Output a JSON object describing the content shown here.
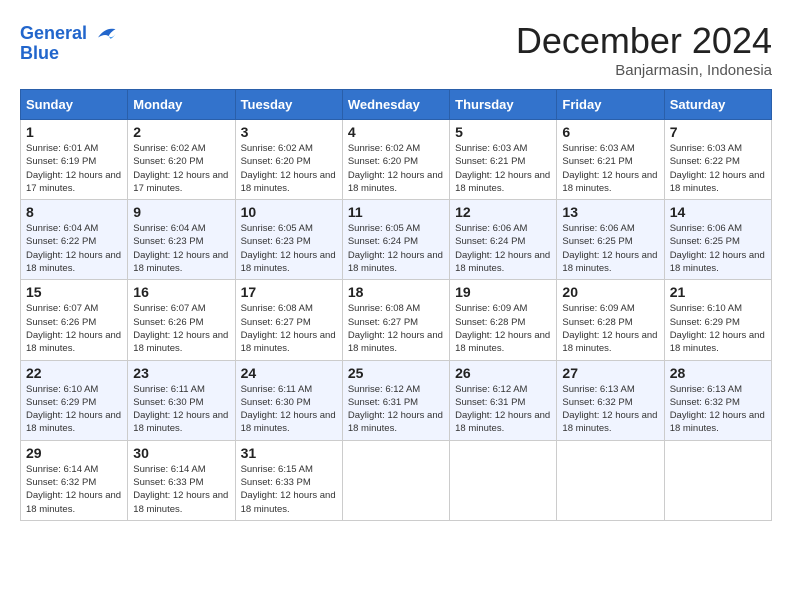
{
  "logo": {
    "line1": "General",
    "line2": "Blue"
  },
  "title": "December 2024",
  "subtitle": "Banjarmasin, Indonesia",
  "days_header": [
    "Sunday",
    "Monday",
    "Tuesday",
    "Wednesday",
    "Thursday",
    "Friday",
    "Saturday"
  ],
  "weeks": [
    [
      {
        "day": "1",
        "sunrise": "6:01 AM",
        "sunset": "6:19 PM",
        "daylight": "12 hours and 17 minutes."
      },
      {
        "day": "2",
        "sunrise": "6:02 AM",
        "sunset": "6:20 PM",
        "daylight": "12 hours and 17 minutes."
      },
      {
        "day": "3",
        "sunrise": "6:02 AM",
        "sunset": "6:20 PM",
        "daylight": "12 hours and 18 minutes."
      },
      {
        "day": "4",
        "sunrise": "6:02 AM",
        "sunset": "6:20 PM",
        "daylight": "12 hours and 18 minutes."
      },
      {
        "day": "5",
        "sunrise": "6:03 AM",
        "sunset": "6:21 PM",
        "daylight": "12 hours and 18 minutes."
      },
      {
        "day": "6",
        "sunrise": "6:03 AM",
        "sunset": "6:21 PM",
        "daylight": "12 hours and 18 minutes."
      },
      {
        "day": "7",
        "sunrise": "6:03 AM",
        "sunset": "6:22 PM",
        "daylight": "12 hours and 18 minutes."
      }
    ],
    [
      {
        "day": "8",
        "sunrise": "6:04 AM",
        "sunset": "6:22 PM",
        "daylight": "12 hours and 18 minutes."
      },
      {
        "day": "9",
        "sunrise": "6:04 AM",
        "sunset": "6:23 PM",
        "daylight": "12 hours and 18 minutes."
      },
      {
        "day": "10",
        "sunrise": "6:05 AM",
        "sunset": "6:23 PM",
        "daylight": "12 hours and 18 minutes."
      },
      {
        "day": "11",
        "sunrise": "6:05 AM",
        "sunset": "6:24 PM",
        "daylight": "12 hours and 18 minutes."
      },
      {
        "day": "12",
        "sunrise": "6:06 AM",
        "sunset": "6:24 PM",
        "daylight": "12 hours and 18 minutes."
      },
      {
        "day": "13",
        "sunrise": "6:06 AM",
        "sunset": "6:25 PM",
        "daylight": "12 hours and 18 minutes."
      },
      {
        "day": "14",
        "sunrise": "6:06 AM",
        "sunset": "6:25 PM",
        "daylight": "12 hours and 18 minutes."
      }
    ],
    [
      {
        "day": "15",
        "sunrise": "6:07 AM",
        "sunset": "6:26 PM",
        "daylight": "12 hours and 18 minutes."
      },
      {
        "day": "16",
        "sunrise": "6:07 AM",
        "sunset": "6:26 PM",
        "daylight": "12 hours and 18 minutes."
      },
      {
        "day": "17",
        "sunrise": "6:08 AM",
        "sunset": "6:27 PM",
        "daylight": "12 hours and 18 minutes."
      },
      {
        "day": "18",
        "sunrise": "6:08 AM",
        "sunset": "6:27 PM",
        "daylight": "12 hours and 18 minutes."
      },
      {
        "day": "19",
        "sunrise": "6:09 AM",
        "sunset": "6:28 PM",
        "daylight": "12 hours and 18 minutes."
      },
      {
        "day": "20",
        "sunrise": "6:09 AM",
        "sunset": "6:28 PM",
        "daylight": "12 hours and 18 minutes."
      },
      {
        "day": "21",
        "sunrise": "6:10 AM",
        "sunset": "6:29 PM",
        "daylight": "12 hours and 18 minutes."
      }
    ],
    [
      {
        "day": "22",
        "sunrise": "6:10 AM",
        "sunset": "6:29 PM",
        "daylight": "12 hours and 18 minutes."
      },
      {
        "day": "23",
        "sunrise": "6:11 AM",
        "sunset": "6:30 PM",
        "daylight": "12 hours and 18 minutes."
      },
      {
        "day": "24",
        "sunrise": "6:11 AM",
        "sunset": "6:30 PM",
        "daylight": "12 hours and 18 minutes."
      },
      {
        "day": "25",
        "sunrise": "6:12 AM",
        "sunset": "6:31 PM",
        "daylight": "12 hours and 18 minutes."
      },
      {
        "day": "26",
        "sunrise": "6:12 AM",
        "sunset": "6:31 PM",
        "daylight": "12 hours and 18 minutes."
      },
      {
        "day": "27",
        "sunrise": "6:13 AM",
        "sunset": "6:32 PM",
        "daylight": "12 hours and 18 minutes."
      },
      {
        "day": "28",
        "sunrise": "6:13 AM",
        "sunset": "6:32 PM",
        "daylight": "12 hours and 18 minutes."
      }
    ],
    [
      {
        "day": "29",
        "sunrise": "6:14 AM",
        "sunset": "6:32 PM",
        "daylight": "12 hours and 18 minutes."
      },
      {
        "day": "30",
        "sunrise": "6:14 AM",
        "sunset": "6:33 PM",
        "daylight": "12 hours and 18 minutes."
      },
      {
        "day": "31",
        "sunrise": "6:15 AM",
        "sunset": "6:33 PM",
        "daylight": "12 hours and 18 minutes."
      },
      null,
      null,
      null,
      null
    ]
  ],
  "labels": {
    "sunrise": "Sunrise: ",
    "sunset": "Sunset: ",
    "daylight": "Daylight: "
  }
}
